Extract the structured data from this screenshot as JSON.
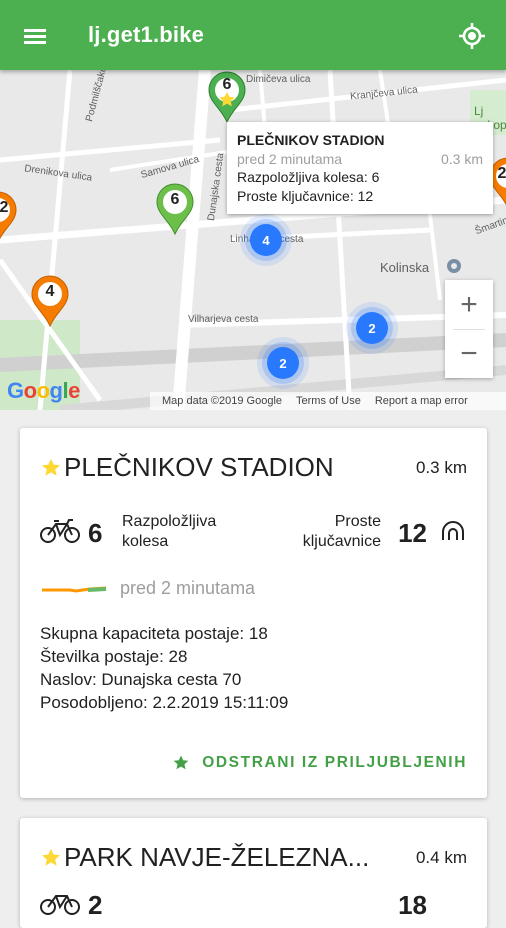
{
  "appbar": {
    "title": "lj.get1.bike",
    "menu_icon": "hamburger-menu-icon",
    "locate_icon": "my-location-icon",
    "color": "#4caf50"
  },
  "map": {
    "street_labels": [
      "Dimičeva ulica",
      "Kranjčeva ulica",
      "Podmilščakova ulica",
      "Samova ulica",
      "Drenikova ulica",
      "Dunajska cesta",
      "Linhartova cesta",
      "Vilharjeva cesta",
      "Kolinska",
      "Šmartinska",
      "Lj pokop"
    ],
    "pins": [
      {
        "count": "6",
        "color": "green",
        "favorite": true
      },
      {
        "count": "6",
        "color": "green",
        "favorite": false
      },
      {
        "count": "4",
        "color": "orange",
        "favorite": false
      },
      {
        "count": "2",
        "color": "orange",
        "favorite": false
      },
      {
        "count": "2",
        "color": "orange",
        "favorite": false
      }
    ],
    "clusters": [
      "4",
      "2",
      "2"
    ],
    "info_window": {
      "title": "PLEČNIKOV STADION",
      "time": "pred 2 minutama",
      "distance": "0.3 km",
      "bikes_line": "Razpoložljiva kolesa: 6",
      "docks_line": "Proste ključavnice: 12"
    },
    "zoom_in": "+",
    "zoom_out": "−",
    "google_logo": "Google",
    "attribution": {
      "map_data": "Map data ©2019 Google",
      "terms": "Terms of Use",
      "report": "Report a map error"
    }
  },
  "stations": [
    {
      "favorite": true,
      "name": "PLEČNIKOV STADION",
      "distance": "0.3 km",
      "bikes": "6",
      "bikes_label_1": "Razpoložljiva",
      "bikes_label_2": "kolesa",
      "docks": "12",
      "docks_label_1": "Proste",
      "docks_label_2": "ključavnice",
      "updated_ago": "pred 2 minutama",
      "capacity": "Skupna kapaciteta postaje: 18",
      "number": "Številka postaje: 28",
      "address": "Naslov: Dunajska cesta 70",
      "updated": "Posodobljeno: 2.2.2019 15:11:09",
      "fav_button": "ODSTRANI IZ PRILJUBLJENIH"
    },
    {
      "favorite": true,
      "name": "PARK NAVJE-ŽELEZNA...",
      "distance": "0.4 km",
      "bikes": "2",
      "docks": "18"
    }
  ],
  "colors": {
    "accent": "#4caf50",
    "fav_green": "#43a047",
    "star": "#fdd835",
    "cluster": "#2979ff",
    "pin_orange": "#f57c00"
  }
}
